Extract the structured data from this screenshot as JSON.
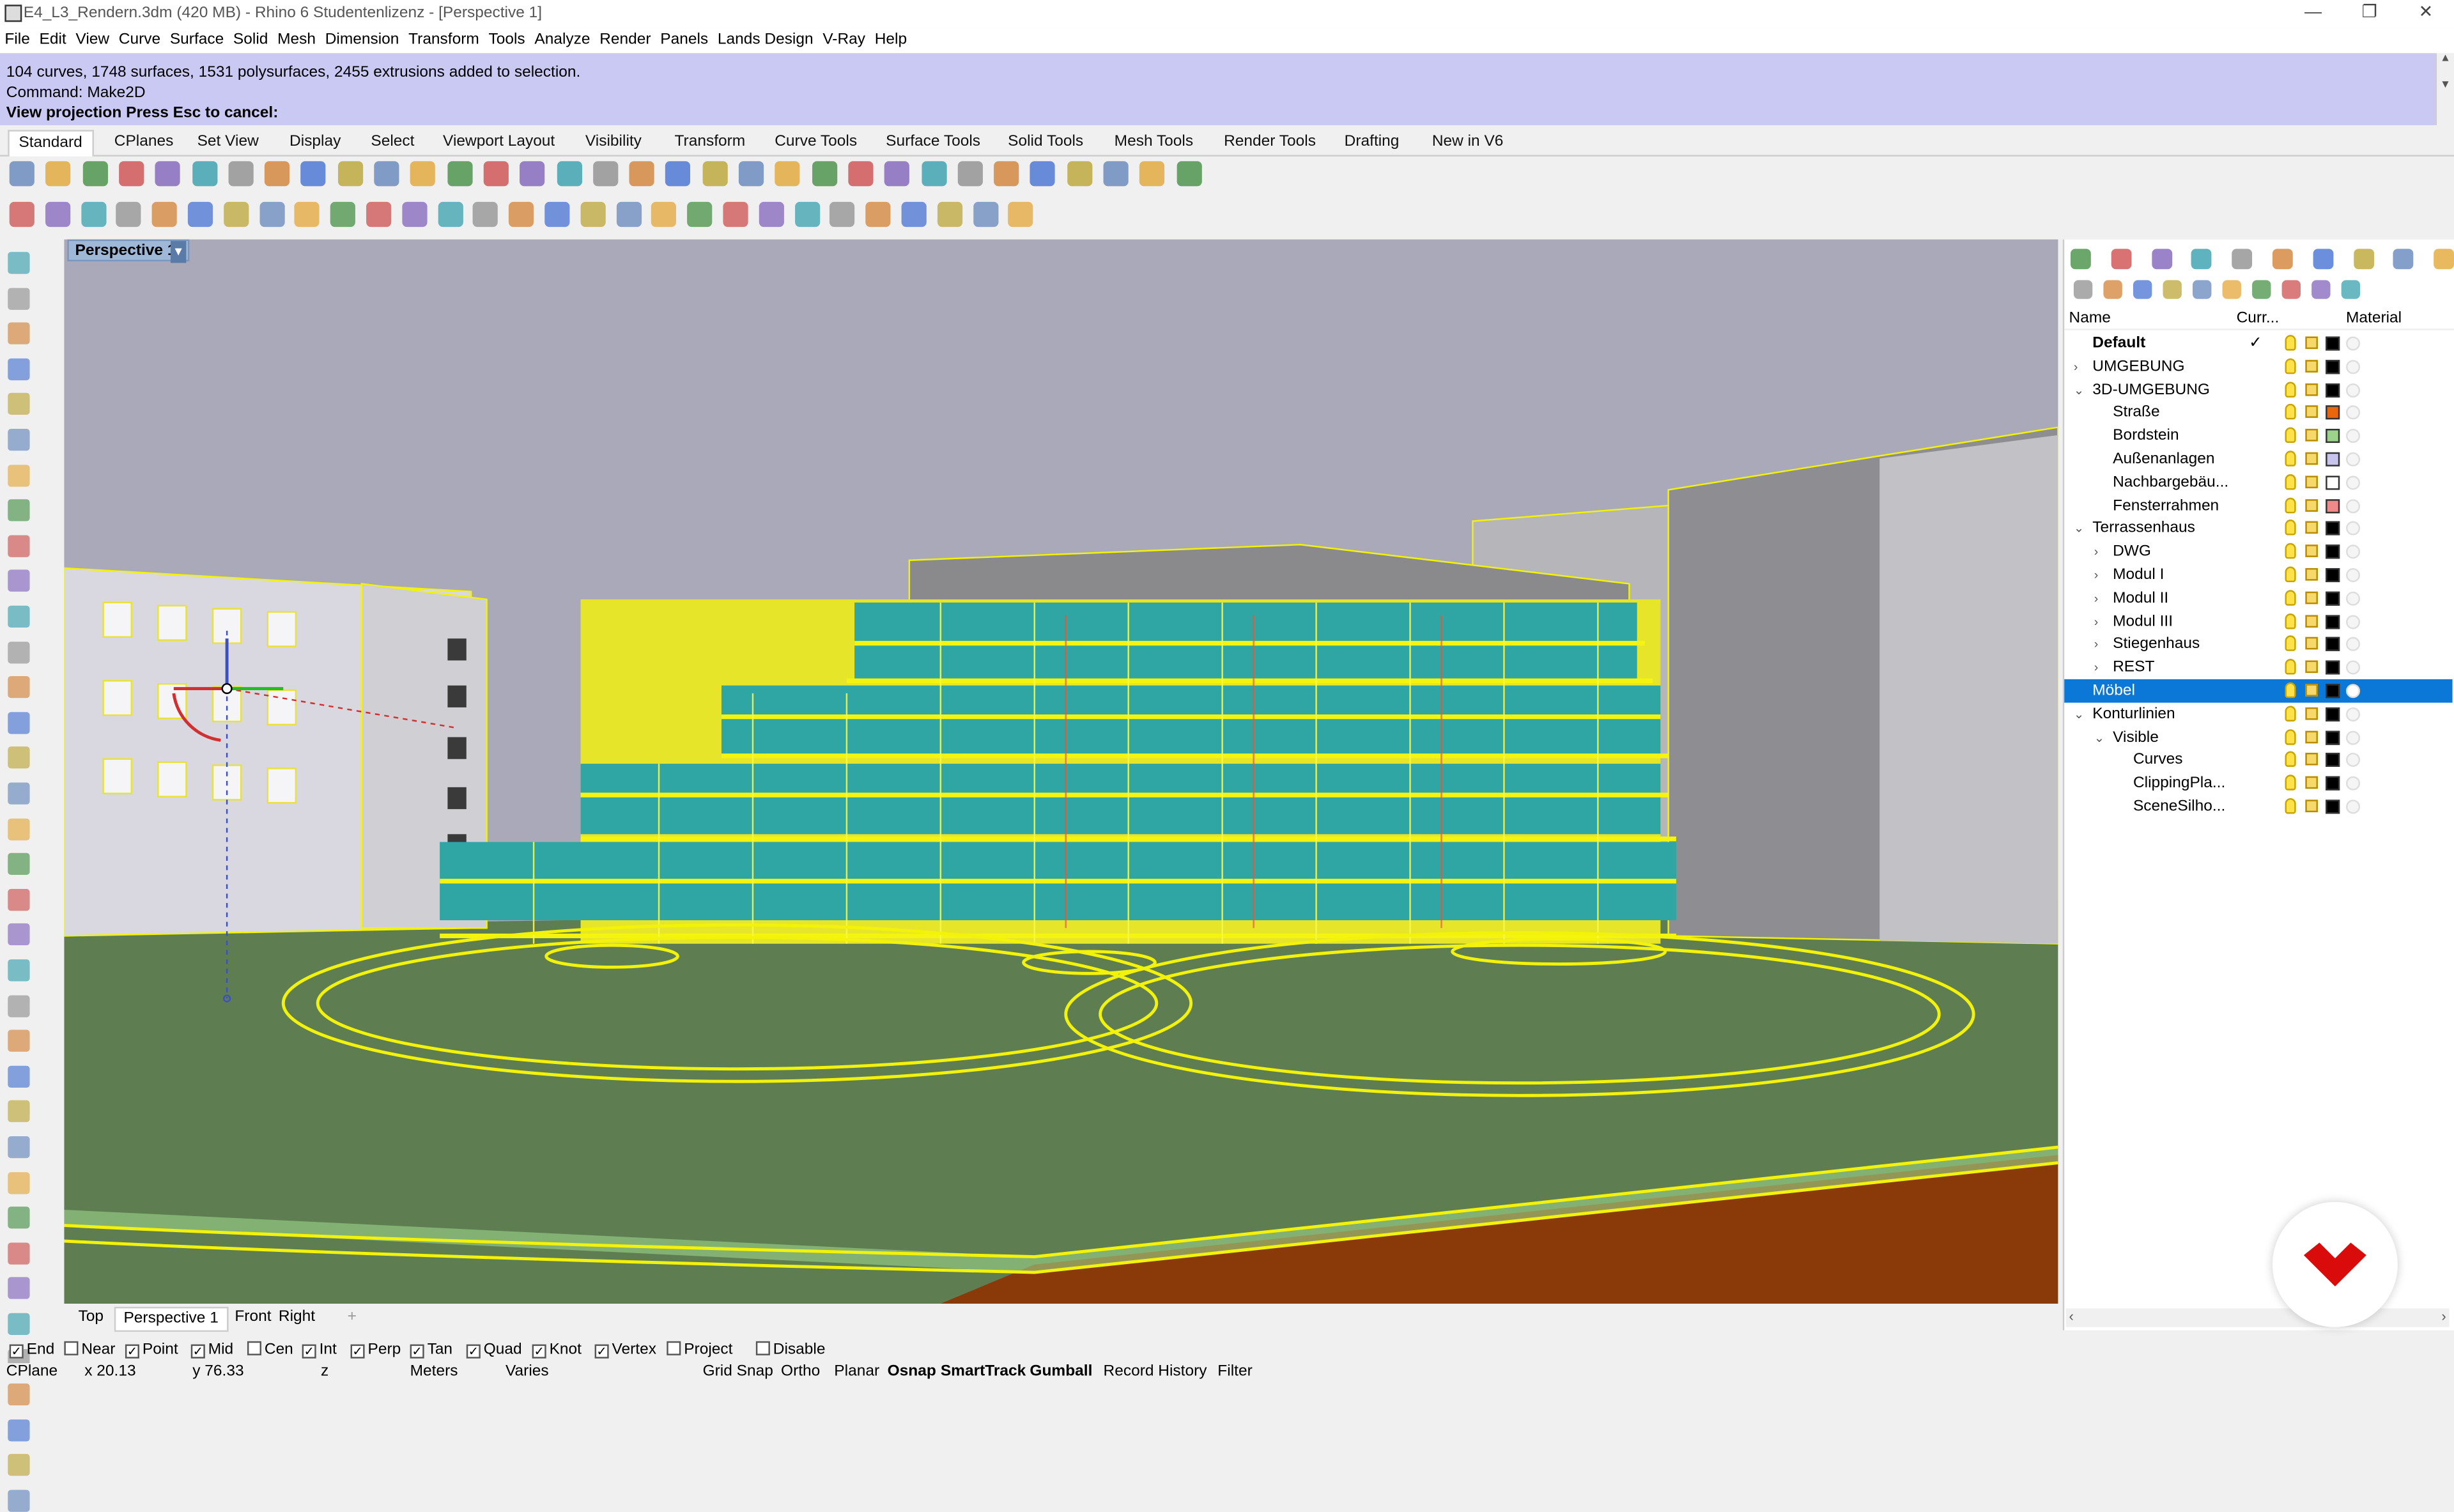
{
  "window": {
    "title": "E4_L3_Rendern.3dm (420 MB) - Rhino 6 Studentenlizenz - [Perspective 1]",
    "minimize": "—",
    "restore": "❐",
    "close": "✕"
  },
  "menu": [
    "File",
    "Edit",
    "View",
    "Curve",
    "Surface",
    "Solid",
    "Mesh",
    "Dimension",
    "Transform",
    "Tools",
    "Analyze",
    "Render",
    "Panels",
    "Lands Design",
    "V-Ray",
    "Help"
  ],
  "command": {
    "history_1": "104 curves, 1748 surfaces, 1531 polysurfaces, 2455 extrusions added to selection.",
    "history_2": "Command: Make2D",
    "prompt": "View projection  Press Esc to cancel:"
  },
  "toolbar_tabs": [
    "Standard",
    "CPlanes",
    "Set View",
    "Display",
    "Select",
    "Viewport Layout",
    "Visibility",
    "Transform",
    "Curve Tools",
    "Surface Tools",
    "Solid Tools",
    "Mesh Tools",
    "Render Tools",
    "Drafting",
    "New in V6"
  ],
  "active_toolbar_tab": "Standard",
  "viewport": {
    "label": "Perspective 1",
    "menu_arrow": "▾"
  },
  "viewport_tabs": [
    "Top",
    "Perspective 1",
    "Front",
    "Right"
  ],
  "add_tab": "+",
  "osnaps": [
    {
      "label": "End",
      "checked": true
    },
    {
      "label": "Near",
      "checked": false
    },
    {
      "label": "Point",
      "checked": true
    },
    {
      "label": "Mid",
      "checked": true
    },
    {
      "label": "Cen",
      "checked": false
    },
    {
      "label": "Int",
      "checked": true
    },
    {
      "label": "Perp",
      "checked": true
    },
    {
      "label": "Tan",
      "checked": true
    },
    {
      "label": "Quad",
      "checked": true
    },
    {
      "label": "Knot",
      "checked": true
    },
    {
      "label": "Vertex",
      "checked": true
    },
    {
      "label": "Project",
      "checked": false
    },
    {
      "label": "Disable",
      "checked": false
    }
  ],
  "status": {
    "cplane": "CPlane",
    "x": "x 20.13",
    "y": "y 76.33",
    "z": "z",
    "units": "Meters",
    "layer": "Varies",
    "grid_snap": "Grid Snap",
    "ortho": "Ortho",
    "planar": "Planar",
    "osnap": "Osnap",
    "smarttrack": "SmartTrack",
    "gumball": "Gumball",
    "record_history": "Record History",
    "filter": "Filter"
  },
  "layers_panel": {
    "col_name": "Name",
    "col_current": "Curr...",
    "col_material": "Material",
    "rows": [
      {
        "name": "Default",
        "level": 0,
        "expander": "",
        "bold": true,
        "current": "✓",
        "color": "#000000"
      },
      {
        "name": "UMGEBUNG",
        "level": 0,
        "expander": "›",
        "color": "#000000"
      },
      {
        "name": "3D-UMGEBUNG",
        "level": 0,
        "expander": "⌄",
        "color": "#000000"
      },
      {
        "name": "Straße",
        "level": 1,
        "expander": "",
        "color": "#e8670c"
      },
      {
        "name": "Bordstein",
        "level": 1,
        "expander": "",
        "color": "#9bd38a"
      },
      {
        "name": "Außenanlagen",
        "level": 1,
        "expander": "",
        "color": "#c8c4f0"
      },
      {
        "name": "Nachbargebäu...",
        "level": 1,
        "expander": "",
        "color": "#ffffff"
      },
      {
        "name": "Fensterrahmen",
        "level": 1,
        "expander": "",
        "color": "#f08a8a"
      },
      {
        "name": "Terrassenhaus",
        "level": 0,
        "expander": "⌄",
        "color": "#000000"
      },
      {
        "name": "DWG",
        "level": 1,
        "expander": "›",
        "color": "#000000"
      },
      {
        "name": "Modul I",
        "level": 1,
        "expander": "›",
        "color": "#000000"
      },
      {
        "name": "Modul II",
        "level": 1,
        "expander": "›",
        "color": "#000000"
      },
      {
        "name": "Modul III",
        "level": 1,
        "expander": "›",
        "color": "#000000"
      },
      {
        "name": "Stiegenhaus",
        "level": 1,
        "expander": "›",
        "color": "#000000"
      },
      {
        "name": "REST",
        "level": 1,
        "expander": "›",
        "color": "#000000"
      },
      {
        "name": "Möbel",
        "level": 0,
        "expander": "",
        "selected": true,
        "color": "#000000"
      },
      {
        "name": "Konturlinien",
        "level": 0,
        "expander": "⌄",
        "color": "#000000"
      },
      {
        "name": "Visible",
        "level": 1,
        "expander": "⌄",
        "color": "#000000"
      },
      {
        "name": "Curves",
        "level": 2,
        "expander": "",
        "color": "#000000"
      },
      {
        "name": "ClippingPla...",
        "level": 2,
        "expander": "",
        "color": "#000000"
      },
      {
        "name": "SceneSilho...",
        "level": 2,
        "expander": "",
        "color": "#000000"
      }
    ]
  },
  "colors": {
    "command_bg": "#c9c9f3",
    "selection": "#0b78d7",
    "wireframe": "#f2f20a",
    "ground": "#5e7d50",
    "sky": "#a8a8b8",
    "logo": "#d90b0b"
  },
  "icons": {
    "toolbar_row1": [
      "new-file-icon",
      "open-icon",
      "save-icon",
      "print-icon",
      "import-icon",
      "cut-icon",
      "copy-icon",
      "paste-icon",
      "undo-icon",
      "pan-icon",
      "rotate-view-icon",
      "zoom-icon",
      "zoom-window-icon",
      "zoom-extents-icon",
      "zoom-selected-icon",
      "undo-view-icon",
      "four-views-icon",
      "car-icon",
      "block-icon",
      "dimension-icon",
      "properties-icon",
      "lightbulb-icon",
      "lock-icon",
      "material-icon",
      "color-wheel-icon",
      "render-icon",
      "shaded-icon",
      "sphere-icon",
      "select-filter-icon",
      "settings-gear-icon",
      "snap-icon",
      "globe-icon",
      "help-icon"
    ],
    "toolbar_row2": [
      "solid-icon",
      "sphere-tool-icon",
      "cap-icon",
      "boolean-icon",
      "surface-icon",
      "loft-icon",
      "box-icon",
      "panel-icon",
      "gear-tool-icon",
      "cone-icon",
      "torus-icon",
      "tent-icon",
      "dimension-tool-icon",
      "explode-icon",
      "half-sphere-icon",
      "planar-surface-icon",
      "sun-icon",
      "split-icon",
      "arrows-icon",
      "hat-icon",
      "cube-icon",
      "cubes-icon",
      "plant-icon",
      "stairs-icon",
      "grid-icon",
      "network-icon",
      "wall-icon",
      "crosshair-icon",
      "frame-icon"
    ],
    "panel_tabs": [
      "properties-tab-icon",
      "colors-tab-icon",
      "materials-tab-icon",
      "layers-tab-icon",
      "display-tab-icon",
      "render-tab-icon",
      "notifications-tab-icon",
      "bug-tab-icon",
      "camera-tab-icon",
      "gear-tab-icon"
    ],
    "panel_tools": [
      "new-layer-icon",
      "new-sublayer-icon",
      "delete-layer-icon",
      "move-up-icon",
      "move-down-icon",
      "move-left-icon",
      "filter-icon",
      "tools-icon",
      "settings-icon",
      "layer-help-icon"
    ]
  }
}
